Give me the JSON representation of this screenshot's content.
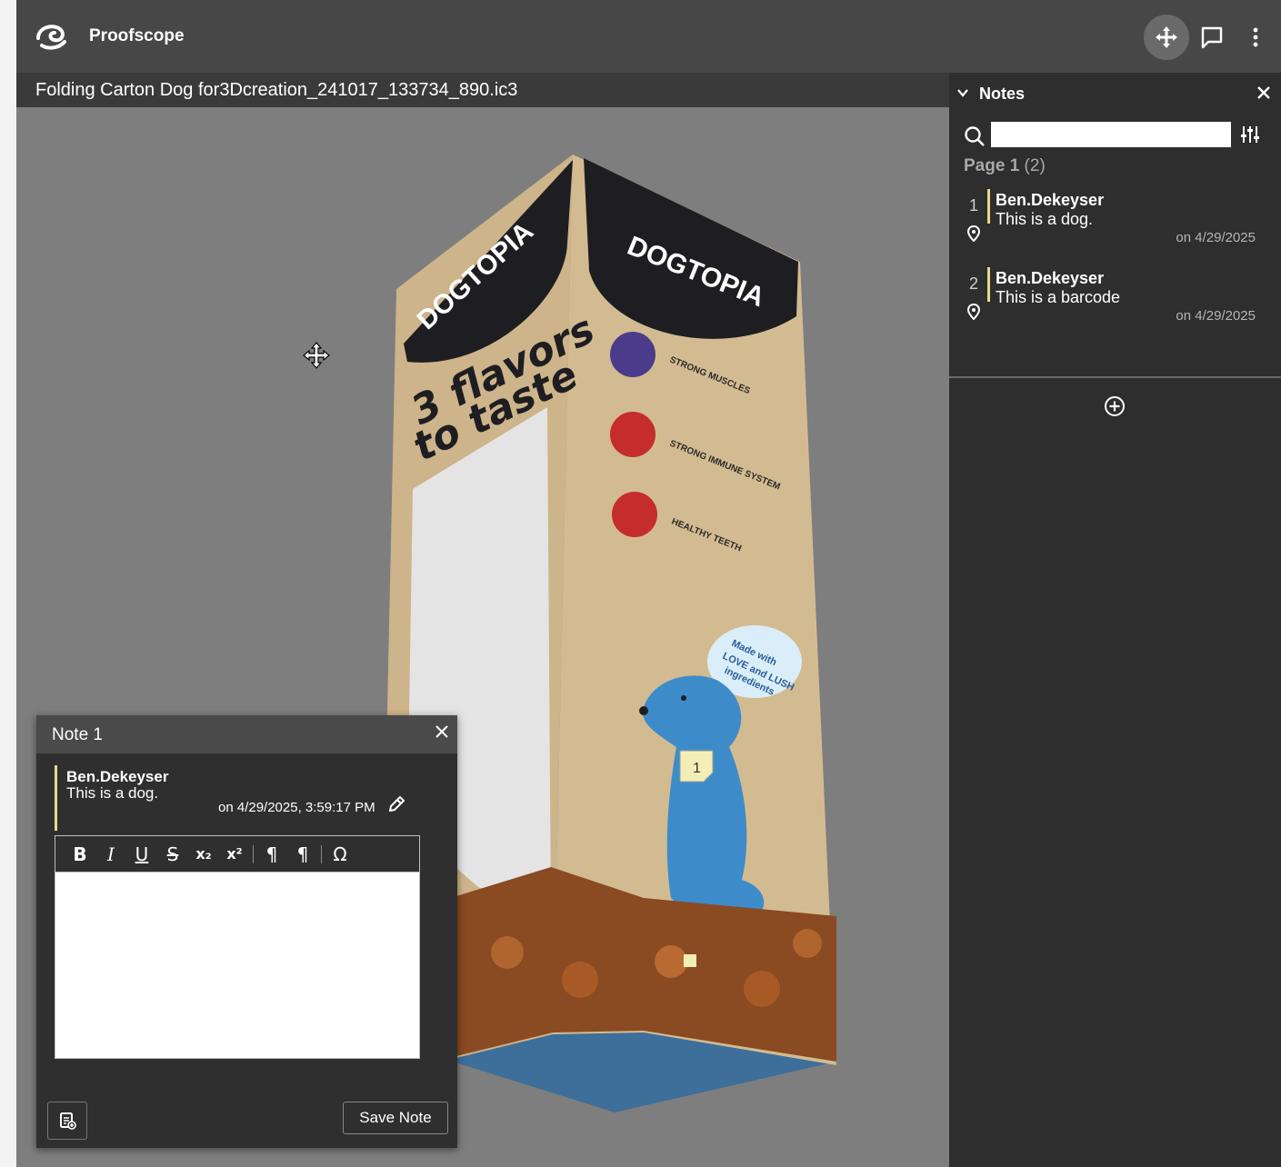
{
  "app": {
    "title": "Proofscope"
  },
  "document": {
    "title": "Folding Carton Dog for3Dcreation_241017_133734_890.ic3"
  },
  "artwork": {
    "brand": "DOGTOPIA",
    "headline_line1": "3 flavors",
    "headline_line2": "to taste",
    "benefits": [
      "STRONG MUSCLES",
      "STRONG IMMUNE SYSTEM",
      "HEALTHY TEETH"
    ],
    "speech_line1": "Made with",
    "speech_line2": "LOVE and LUSH",
    "speech_line3": "ingredients",
    "marker_label": "1"
  },
  "notes_panel": {
    "title": "Notes",
    "search_placeholder": "",
    "page_label": "Page 1",
    "page_count": "(2)",
    "notes": [
      {
        "number": "1",
        "author": "Ben.Dekeyser",
        "text": "This is a dog.",
        "date": "on 4/29/2025"
      },
      {
        "number": "2",
        "author": "Ben.Dekeyser",
        "text": "This is a barcode",
        "date": "on 4/29/2025"
      }
    ]
  },
  "note_popup": {
    "title": "Note 1",
    "author": "Ben.Dekeyser",
    "text": "This is a dog.",
    "date": "on 4/29/2025, 3:59:17 PM",
    "toolbar": [
      "B",
      "I",
      "U",
      "S",
      "x₂",
      "x²",
      "¶",
      "¶",
      "Ω"
    ],
    "save_label": "Save Note"
  },
  "colors": {
    "accent": "#e8d888",
    "carton": "#cdb48a",
    "dog": "#3d8cc9"
  }
}
